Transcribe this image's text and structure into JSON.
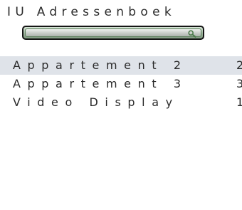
{
  "app": {
    "title": "IU Adressenboek"
  },
  "search": {
    "value": "",
    "placeholder": "",
    "icon": "search-icon"
  },
  "colors": {
    "selected_row": "#dfe3e9",
    "search_field_green": "#9fb69f",
    "text": "#2a2a2a"
  },
  "entries": [
    {
      "name": "Appartement 2",
      "number": "2",
      "selected": true
    },
    {
      "name": "Appartement 3",
      "number": "3",
      "selected": false
    },
    {
      "name": "Video Display",
      "number": "1",
      "selected": false
    }
  ]
}
